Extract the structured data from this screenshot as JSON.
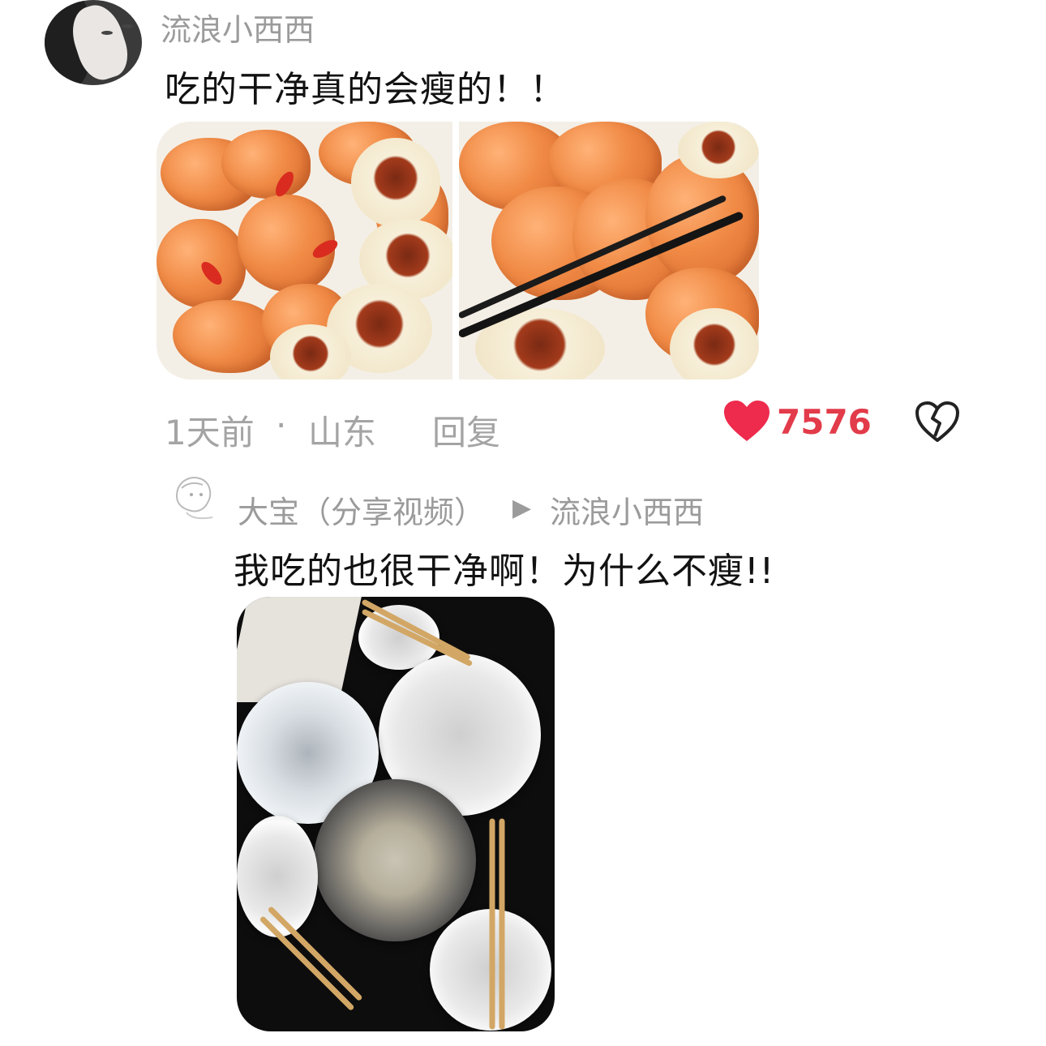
{
  "comment": {
    "username": "流浪小西西",
    "text": "吃的干净真的会瘦的！！",
    "time": "1天前",
    "dot": "·",
    "location": "山东",
    "reply_label": "回复",
    "likes": "7576",
    "icons": {
      "like": "heart-icon",
      "dislike": "broken-heart-icon"
    },
    "colors": {
      "like": "#e23b4a",
      "meta": "#a4a4a4"
    }
  },
  "reply": {
    "username": "大宝",
    "tag": "（分享视频）",
    "arrow": "▶",
    "to_user": "流浪小西西",
    "text": "我吃的也很干净啊！为什么不瘦!!"
  }
}
